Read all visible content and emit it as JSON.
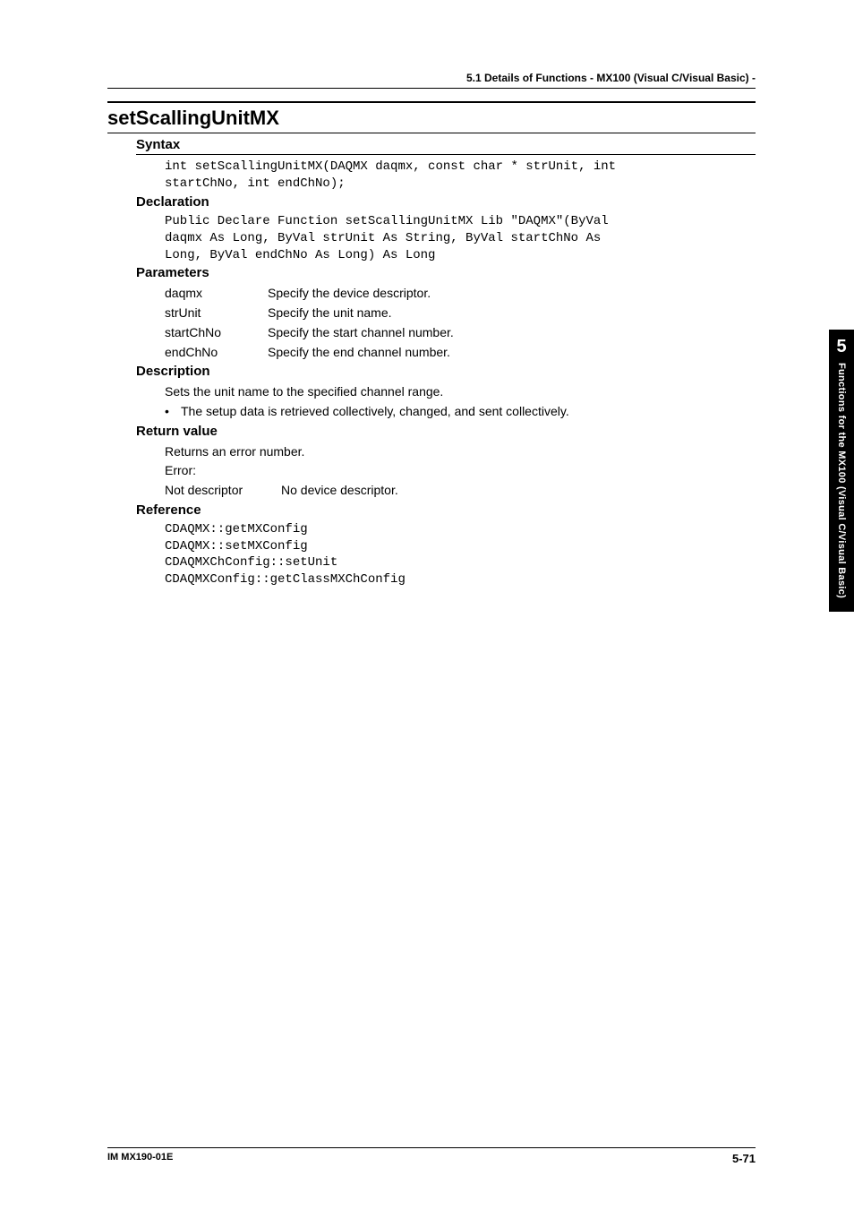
{
  "breadcrumb": "5.1  Details of Functions - MX100 (Visual C/Visual Basic) -",
  "func_title": "setScallingUnitMX",
  "syntax": {
    "heading": "Syntax",
    "code": "int setScallingUnitMX(DAQMX daqmx, const char * strUnit, int\nstartChNo, int endChNo);"
  },
  "declaration": {
    "heading": "Declaration",
    "code": "Public Declare Function setScallingUnitMX Lib \"DAQMX\"(ByVal\ndaqmx As Long, ByVal strUnit As String, ByVal startChNo As\nLong, ByVal endChNo As Long) As Long"
  },
  "parameters": {
    "heading": "Parameters",
    "rows": [
      {
        "name": "daqmx",
        "desc": "Specify the device descriptor."
      },
      {
        "name": "strUnit",
        "desc": "Specify the unit name."
      },
      {
        "name": "startChNo",
        "desc": "Specify the start channel number."
      },
      {
        "name": "endChNo",
        "desc": "Specify the end channel number."
      }
    ]
  },
  "description": {
    "heading": "Description",
    "line1": "Sets the unit name to the specified channel range.",
    "bullet1": "The setup data is retrieved collectively, changed, and sent collectively."
  },
  "return_value": {
    "heading": "Return value",
    "line1": "Returns an error number.",
    "line2": "Error:",
    "err_name": "Not descriptor",
    "err_desc": "No device descriptor."
  },
  "reference": {
    "heading": "Reference",
    "code": "CDAQMX::getMXConfig\nCDAQMX::setMXConfig\nCDAQMXChConfig::setUnit\nCDAQMXConfig::getClassMXChConfig"
  },
  "side_tab": {
    "num": "5",
    "text": "Functions for the MX100 (Visual C/Visual Basic)"
  },
  "footer": {
    "left": "IM MX190-01E",
    "right": "5-71"
  }
}
